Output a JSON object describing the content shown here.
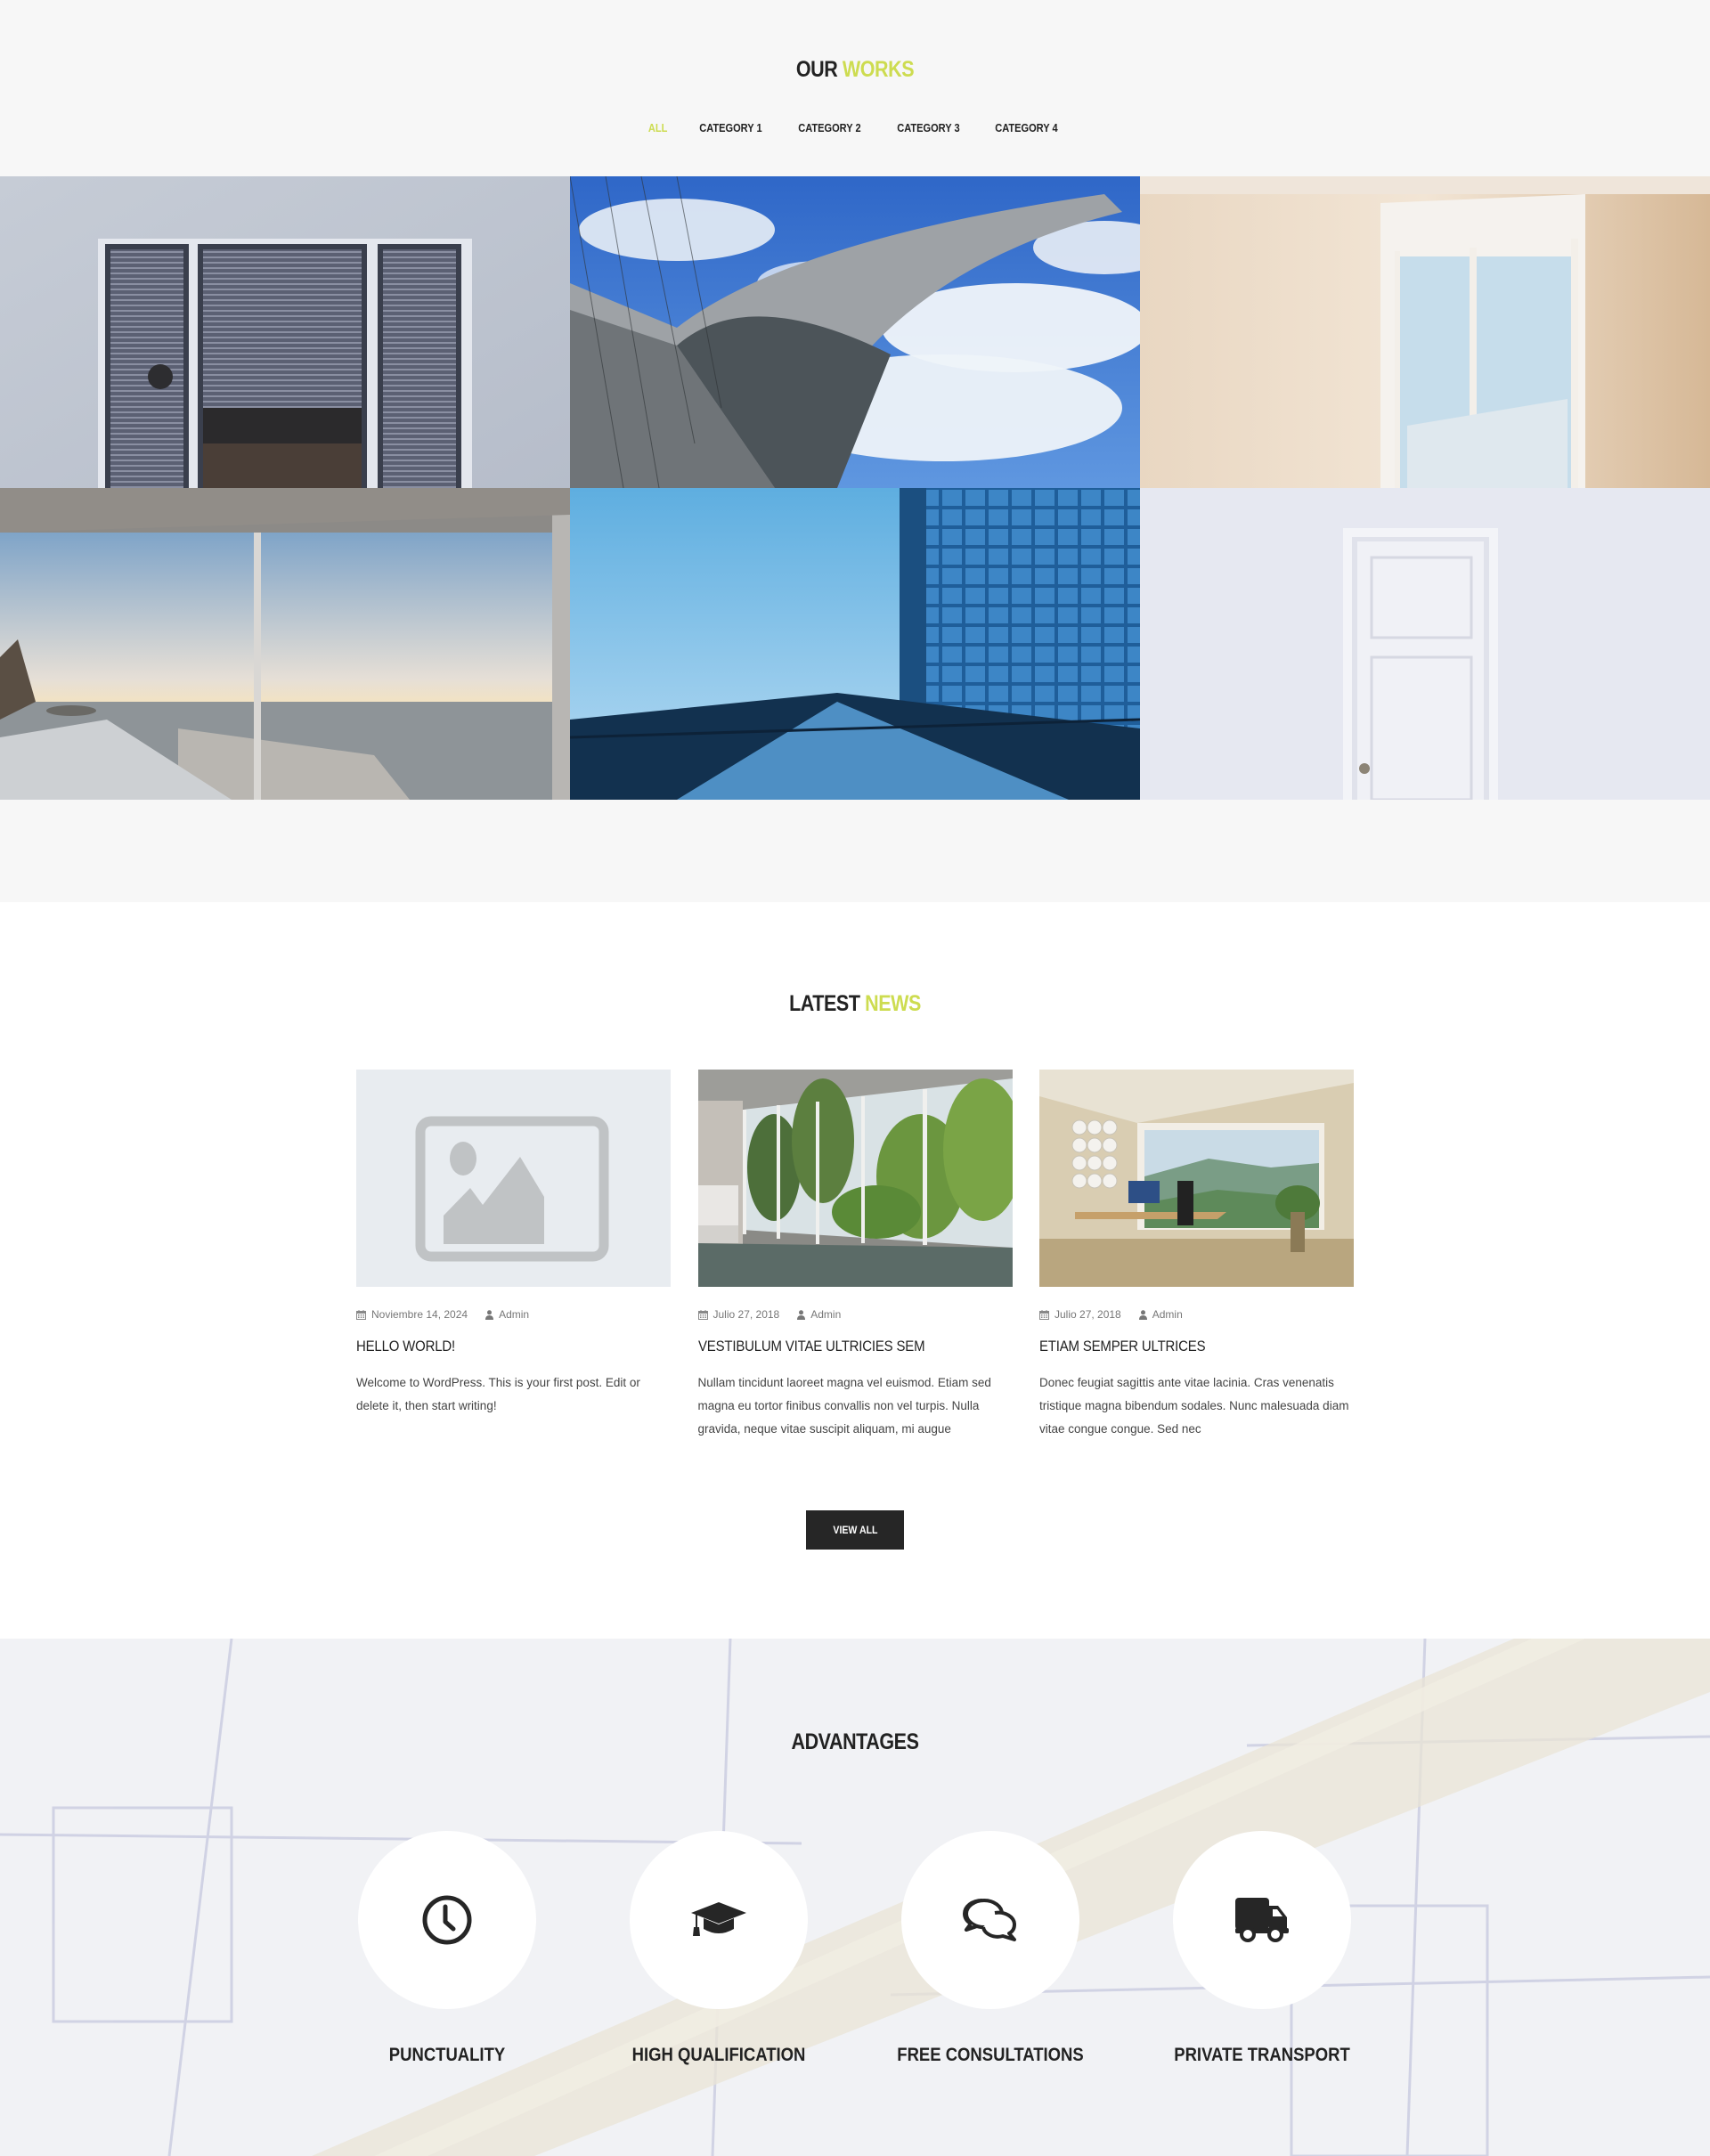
{
  "works": {
    "title_main": "OUR",
    "title_accent": "WORKS",
    "filters": [
      {
        "label": "ALL",
        "active": true
      },
      {
        "label": "CATEGORY 1",
        "active": false
      },
      {
        "label": "CATEGORY 2",
        "active": false
      },
      {
        "label": "CATEGORY 3",
        "active": false
      },
      {
        "label": "CATEGORY 4",
        "active": false
      }
    ],
    "tiles": [
      {
        "subject": "window-blinds"
      },
      {
        "subject": "curved-roof-building"
      },
      {
        "subject": "room-window"
      },
      {
        "subject": "sea-view-window"
      },
      {
        "subject": "glass-skyscraper"
      },
      {
        "subject": "white-door"
      }
    ]
  },
  "news": {
    "title_main": "LATEST",
    "title_accent": "NEWS",
    "posts": [
      {
        "date": "Noviembre 14, 2024",
        "author": "Admin",
        "title": "HELLO WORLD!",
        "excerpt": "Welcome to WordPress. This is your first post. Edit or delete it, then start writing!",
        "image": "placeholder-image"
      },
      {
        "date": "Julio 27, 2018",
        "author": "Admin",
        "title": "VESTIBULUM VITAE ULTRICIES SEM",
        "excerpt": "Nullam tincidunt laoreet magna vel euismod. Etiam sed magna eu tortor finibus convallis non vel turpis. Nulla gravida, neque vitae suscipit aliquam, mi augue",
        "image": "living-room-trees"
      },
      {
        "date": "Julio 27, 2018",
        "author": "Admin",
        "title": "ETIAM SEMPER ULTRICES",
        "excerpt": "Donec feugiat sagittis ante vitae lacinia. Cras venenatis tristique magna bibendum sodales. Nunc malesuada diam vitae congue congue. Sed nec",
        "image": "office-mountain-view"
      }
    ],
    "view_all_label": "VIEW ALL"
  },
  "advantages": {
    "title": "ADVANTAGES",
    "items": [
      {
        "label": "PUNCTUALITY",
        "icon": "clock-icon"
      },
      {
        "label": "HIGH QUALIFICATION",
        "icon": "graduation-cap-icon"
      },
      {
        "label": "FREE CONSULTATIONS",
        "icon": "chat-bubbles-icon"
      },
      {
        "label": "PRIVATE TRANSPORT",
        "icon": "truck-icon"
      }
    ]
  },
  "colors": {
    "accent": "#cddc50",
    "text_dark": "#222222",
    "works_bg": "#f7f7f7",
    "button_bg": "#262626"
  }
}
